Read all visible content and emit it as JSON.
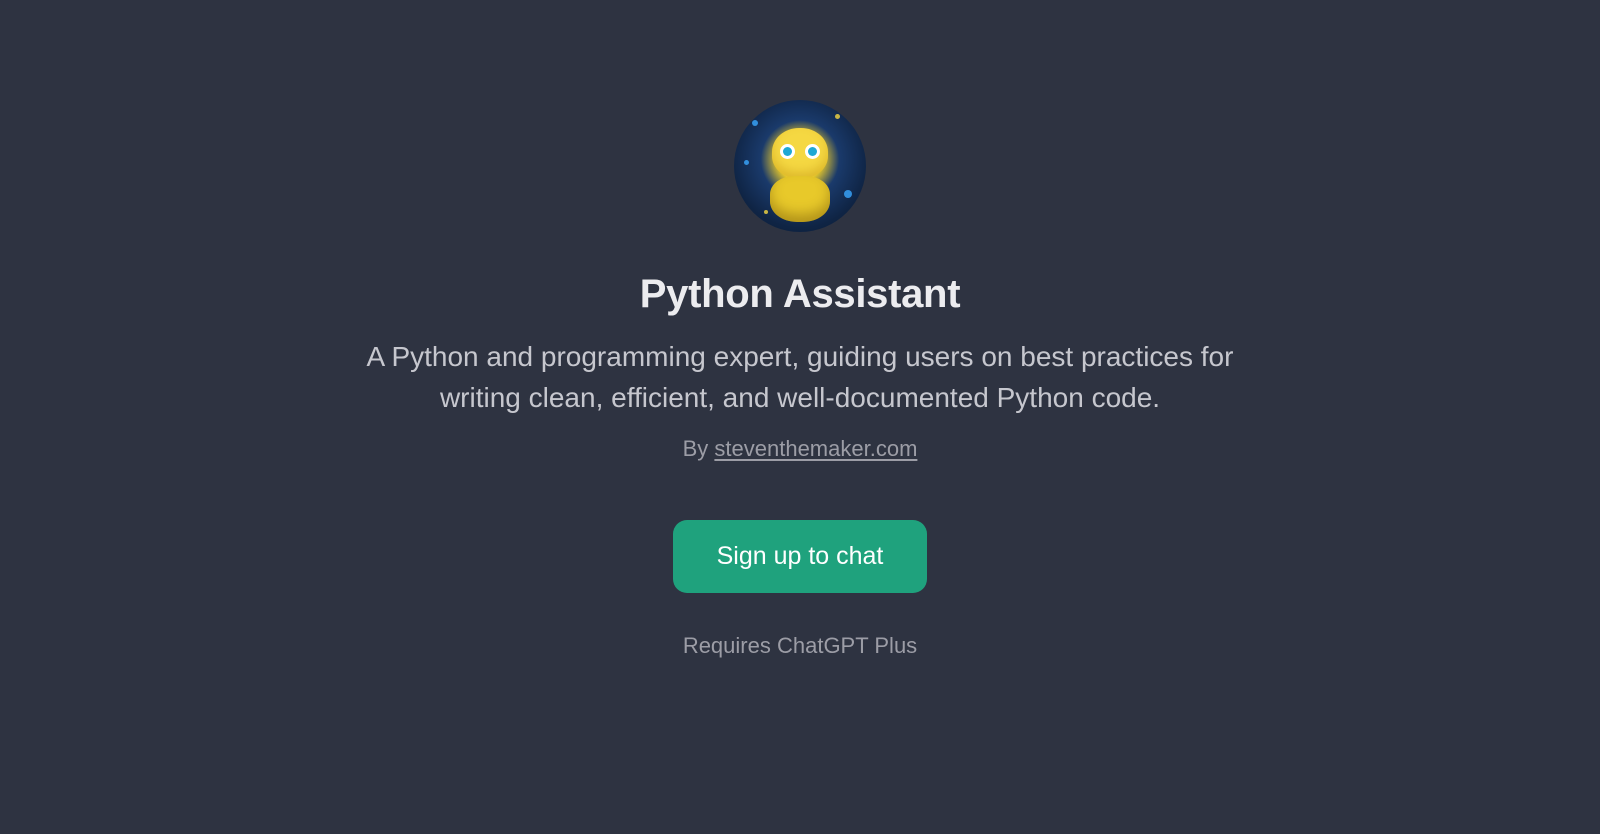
{
  "profile": {
    "title": "Python Assistant",
    "description": "A Python and programming expert, guiding users on best practices for writing clean, efficient, and well-documented Python code.",
    "author_prefix": "By ",
    "author_link": "steventhemaker.com"
  },
  "cta": {
    "label": "Sign up to chat",
    "requires": "Requires ChatGPT Plus"
  }
}
